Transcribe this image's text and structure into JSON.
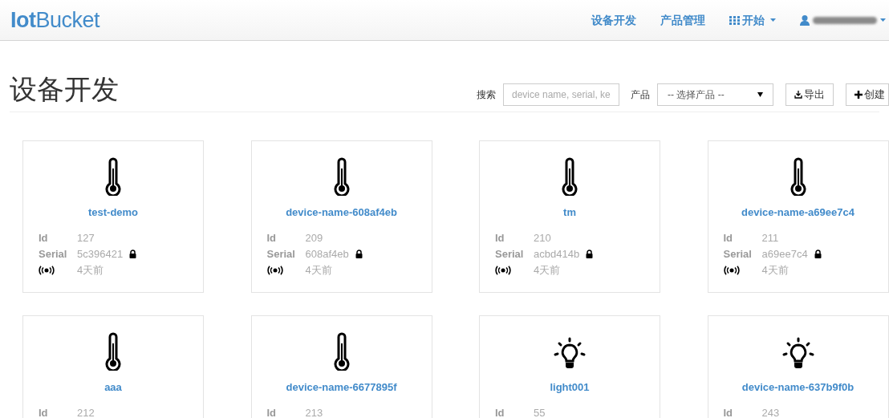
{
  "navbar": {
    "brand": "**Iot**Bucket",
    "links": [
      {
        "label": "设备开发",
        "kind": "link"
      },
      {
        "label": "产品管理",
        "kind": "link"
      },
      {
        "label": "开始",
        "kind": "menu"
      }
    ]
  },
  "page": {
    "title": "设备开发",
    "search": {
      "label": "搜索",
      "placeholder": "device name, serial, ke"
    },
    "product": {
      "label": "产品",
      "value": "-- 选择产品 --"
    },
    "buttons": [
      {
        "label": "导出",
        "kind": "export"
      },
      {
        "label": "创建",
        "kind": "create"
      }
    ]
  },
  "devices": [
    {
      "kind": "thermometer",
      "name": "test-demo",
      "id_label": "Id",
      "id": "127",
      "serial_label": "Serial",
      "serial": "5c396421",
      "seen": "4天前"
    },
    {
      "kind": "thermometer",
      "name": "device-name-608af4eb",
      "id_label": "Id",
      "id": "209",
      "serial_label": "Serial",
      "serial": "608af4eb",
      "seen": "4天前"
    },
    {
      "kind": "thermometer",
      "name": "tm",
      "id_label": "Id",
      "id": "210",
      "serial_label": "Serial",
      "serial": "acbd414b",
      "seen": "4天前"
    },
    {
      "kind": "thermometer",
      "name": "device-name-a69ee7c4",
      "id_label": "Id",
      "id": "211",
      "serial_label": "Serial",
      "serial": "a69ee7c4",
      "seen": "4天前"
    },
    {
      "kind": "thermometer",
      "name": "aaa",
      "id_label": "Id",
      "id": "212"
    },
    {
      "kind": "thermometer",
      "name": "device-name-6677895f",
      "id_label": "Id",
      "id": "213"
    },
    {
      "kind": "bulb",
      "name": "light001",
      "id_label": "Id",
      "id": "55"
    },
    {
      "kind": "bulb",
      "name": "device-name-637b9f0b",
      "id_label": "Id",
      "id": "243"
    }
  ]
}
